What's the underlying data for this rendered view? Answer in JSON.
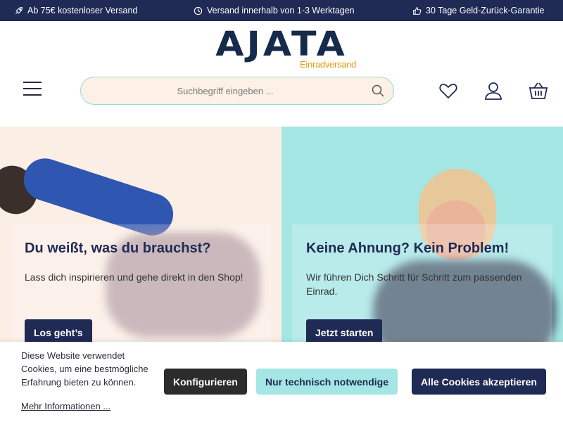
{
  "topbar": {
    "usps": [
      {
        "icon": "rocket-icon",
        "text": "Ab 75€ kostenloser Versand"
      },
      {
        "icon": "clock-icon",
        "text": "Versand innerhalb von 1-3 Werktagen"
      },
      {
        "icon": "thumbs-up-icon",
        "text": "30 Tage Geld-Zurück-Garantie"
      }
    ]
  },
  "header": {
    "logo_main": "AJATA",
    "logo_sub": "Einradversand",
    "search_placeholder": "Suchbegriff eingeben ..."
  },
  "tiles": [
    {
      "title": "Du weißt, was du brauchst?",
      "text": "Lass dich inspirieren und gehe direkt in den Shop!",
      "button": "Los geht’s"
    },
    {
      "title": "Keine Ahnung? Kein Problem!",
      "text": "Wir führen Dich Schritt für Schritt zum passenden Einrad.",
      "button": "Jetzt starten"
    }
  ],
  "cookie": {
    "text": "Diese Website verwendet Cookies, um eine bestmögliche Erfahrung bieten zu können.",
    "link": "Mehr Informationen ...",
    "configure": "Konfigurieren",
    "technical": "Nur technisch notwendige",
    "accept_all": "Alle Cookies akzeptieren"
  },
  "colors": {
    "navy": "#1f2a55",
    "mint": "#a4e6e3",
    "peach": "#fbeee4",
    "logo_orange": "#e09a14"
  }
}
